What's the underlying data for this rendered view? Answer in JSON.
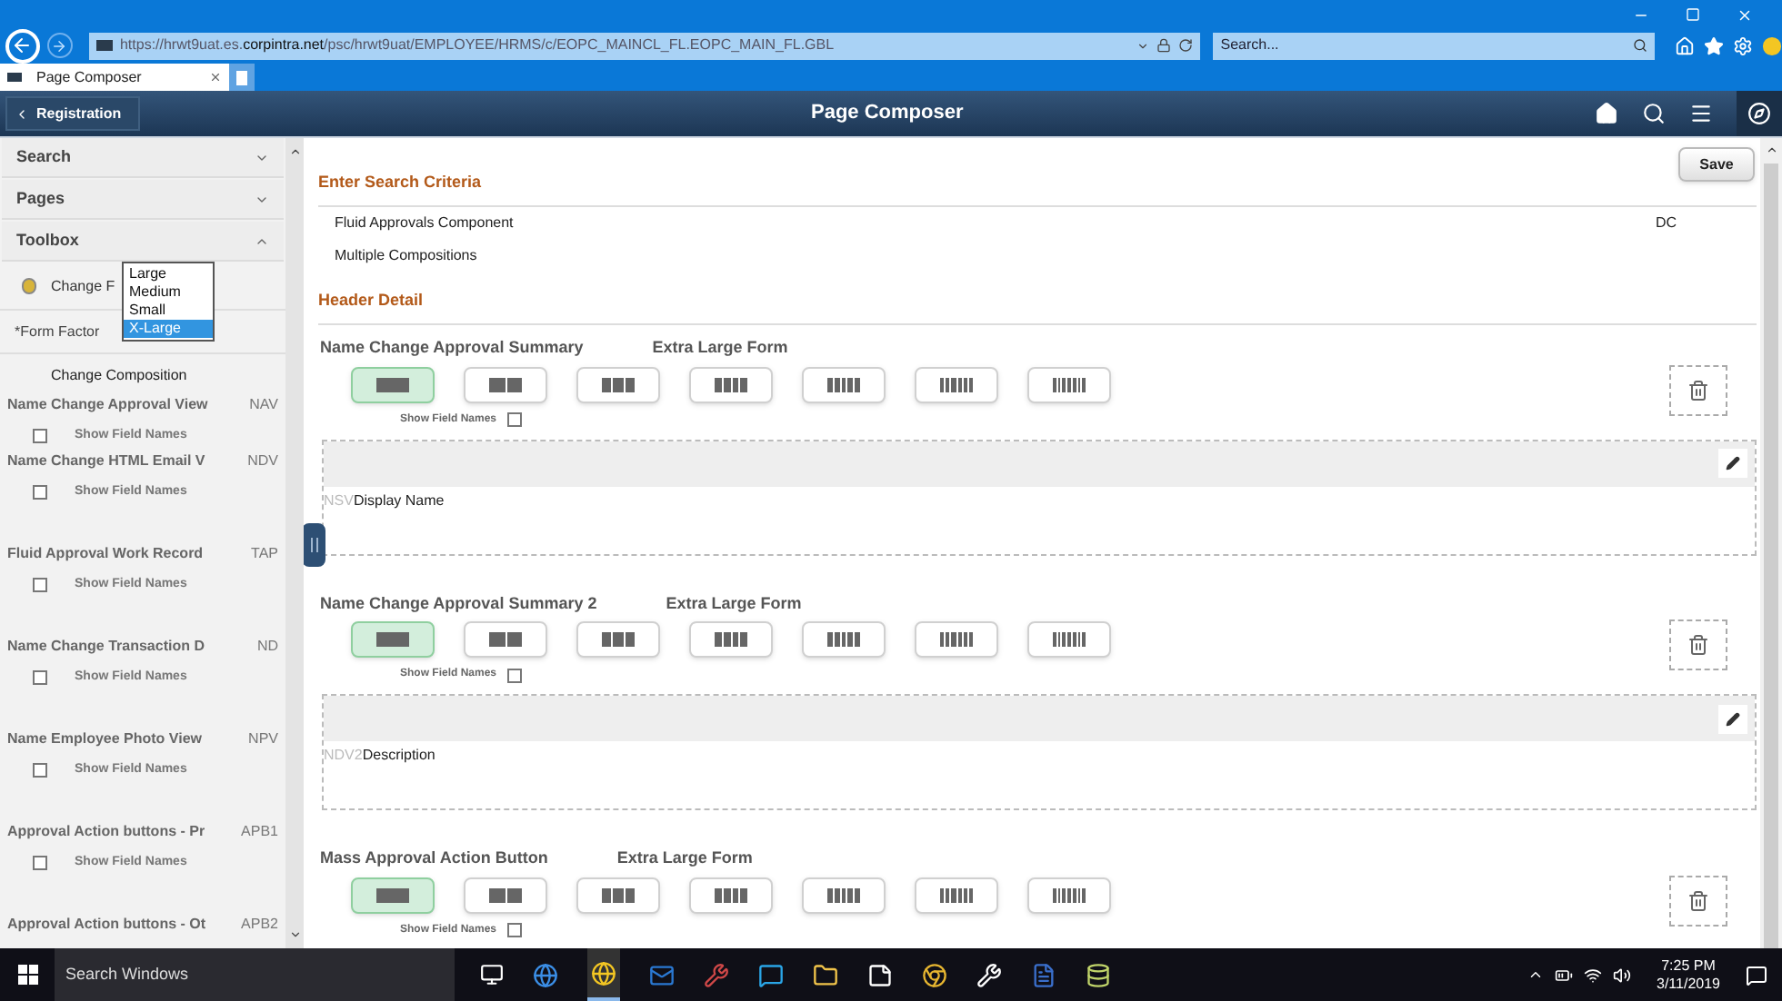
{
  "browser": {
    "url_parts": [
      {
        "text": "https://",
        "kind": "dim"
      },
      {
        "text": "hrwt9uat.es.",
        "kind": "dim"
      },
      {
        "text": "corpintra.net",
        "kind": "strong"
      },
      {
        "text": "/psc/hrwt9uat/EMPLOYEE/HRMS/c/EOPC_MAINCL_FL.EOPC_MAIN_FL.GBL",
        "kind": "dim"
      }
    ],
    "search_placeholder": "Search...",
    "tab_title": "Page Composer"
  },
  "header": {
    "back_label": "Registration",
    "title": "Page Composer"
  },
  "sidebar": {
    "sections": [
      {
        "label": "Search",
        "expanded": false
      },
      {
        "label": "Pages",
        "expanded": false
      },
      {
        "label": "Toolbox",
        "expanded": true
      }
    ],
    "tool_label": "Change F",
    "dropdown": [
      {
        "label": "Large",
        "selected": false
      },
      {
        "label": "Medium",
        "selected": false
      },
      {
        "label": "Small",
        "selected": false
      },
      {
        "label": "X-Large",
        "selected": true
      }
    ],
    "form_factor_label": "*Form Factor",
    "composition_title": "Change Composition",
    "compositions": [
      {
        "name": "Name Change Approval View",
        "code": "NAV",
        "field_names_label": "Show Field Names",
        "checked": false
      },
      {
        "name": "Name Change HTML Email V",
        "code": "NDV",
        "field_names_label": "Show Field Names",
        "checked": false
      },
      {
        "name": "Fluid Approval Work Record",
        "code": "TAP",
        "field_names_label": "Show Field Names",
        "checked": false
      },
      {
        "name": "Name Change Transaction D",
        "code": "ND",
        "field_names_label": "Show Field Names",
        "checked": false
      },
      {
        "name": "Name Employee Photo View",
        "code": "NPV",
        "field_names_label": "Show Field Names",
        "checked": false
      },
      {
        "name": "Approval Action buttons - Pr",
        "code": "APB1",
        "field_names_label": "Show Field Names",
        "checked": false
      },
      {
        "name": "Approval Action buttons - Ot",
        "code": "APB2"
      }
    ]
  },
  "main": {
    "save_label": "Save",
    "criteria_title": "Enter Search Criteria",
    "criteria_rows": [
      {
        "label": "Fluid Approvals Component",
        "value": "DC"
      },
      {
        "label": "Multiple Compositions"
      }
    ],
    "detail_title": "Header Detail",
    "sections": [
      {
        "name": "Name Change Approval Summary",
        "form": "Extra Large Form",
        "layouts": [
          {
            "selected": true
          },
          {
            "selected": false
          },
          {
            "selected": false
          },
          {
            "selected": false
          },
          {
            "selected": false
          },
          {
            "selected": false
          },
          {
            "selected": false
          }
        ],
        "field_names_label": "Show Field Names",
        "checked": false,
        "panel": {
          "code": "NSV",
          "label": "Display Name"
        }
      },
      {
        "name": "Name Change Approval Summary 2",
        "form": "Extra Large Form",
        "layouts": [
          {
            "selected": true
          },
          {
            "selected": false
          },
          {
            "selected": false
          },
          {
            "selected": false
          },
          {
            "selected": false
          },
          {
            "selected": false
          },
          {
            "selected": false
          }
        ],
        "field_names_label": "Show Field Names",
        "checked": false,
        "panel": {
          "code": "NDV2",
          "label": "Description"
        }
      },
      {
        "name": "Mass Approval Action Button",
        "form": "Extra Large Form",
        "layouts": [
          {
            "selected": true
          },
          {
            "selected": false
          },
          {
            "selected": false
          },
          {
            "selected": false
          },
          {
            "selected": false
          },
          {
            "selected": false
          },
          {
            "selected": false
          }
        ],
        "field_names_label": "Show Field Names",
        "checked": false
      }
    ]
  },
  "taskbar": {
    "search_placeholder": "Search Windows",
    "time": "7:25 PM",
    "date": "3/11/2019"
  }
}
